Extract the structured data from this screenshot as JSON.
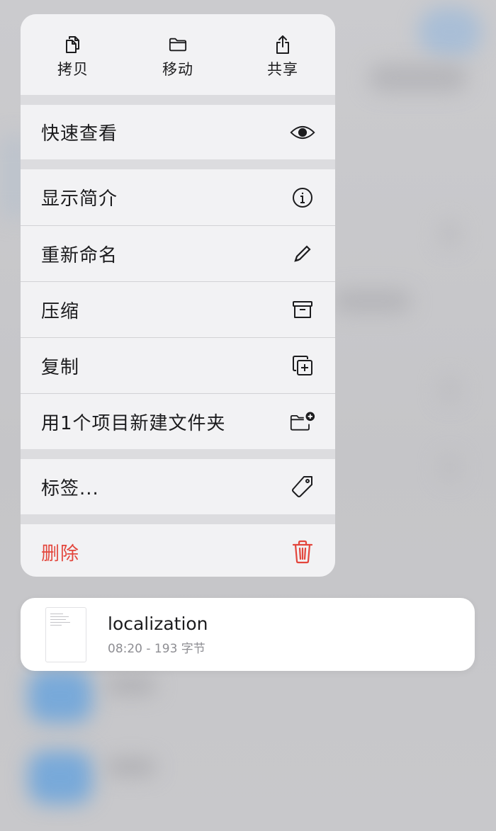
{
  "menu": {
    "top_actions": [
      {
        "label": "拷贝",
        "icon": "copy-icon"
      },
      {
        "label": "移动",
        "icon": "folder-icon"
      },
      {
        "label": "共享",
        "icon": "share-icon"
      }
    ],
    "items": {
      "quick_look": {
        "label": "快速查看",
        "icon": "eye-icon"
      },
      "get_info": {
        "label": "显示简介",
        "icon": "info-icon"
      },
      "rename": {
        "label": "重新命名",
        "icon": "pencil-icon"
      },
      "compress": {
        "label": "压缩",
        "icon": "archive-box-icon"
      },
      "duplicate": {
        "label": "复制",
        "icon": "duplicate-icon"
      },
      "new_folder": {
        "label": "用1个项目新建文件夹",
        "icon": "folder-plus-icon"
      },
      "tags": {
        "label": "标签...",
        "icon": "tag-icon"
      },
      "delete": {
        "label": "删除",
        "icon": "trash-icon"
      }
    }
  },
  "file": {
    "name": "localization",
    "meta": "08:20 - 193 字节"
  },
  "colors": {
    "danger": "#e3463c",
    "menu_bg": "#f2f2f4",
    "separator": "#dcdcdf"
  }
}
